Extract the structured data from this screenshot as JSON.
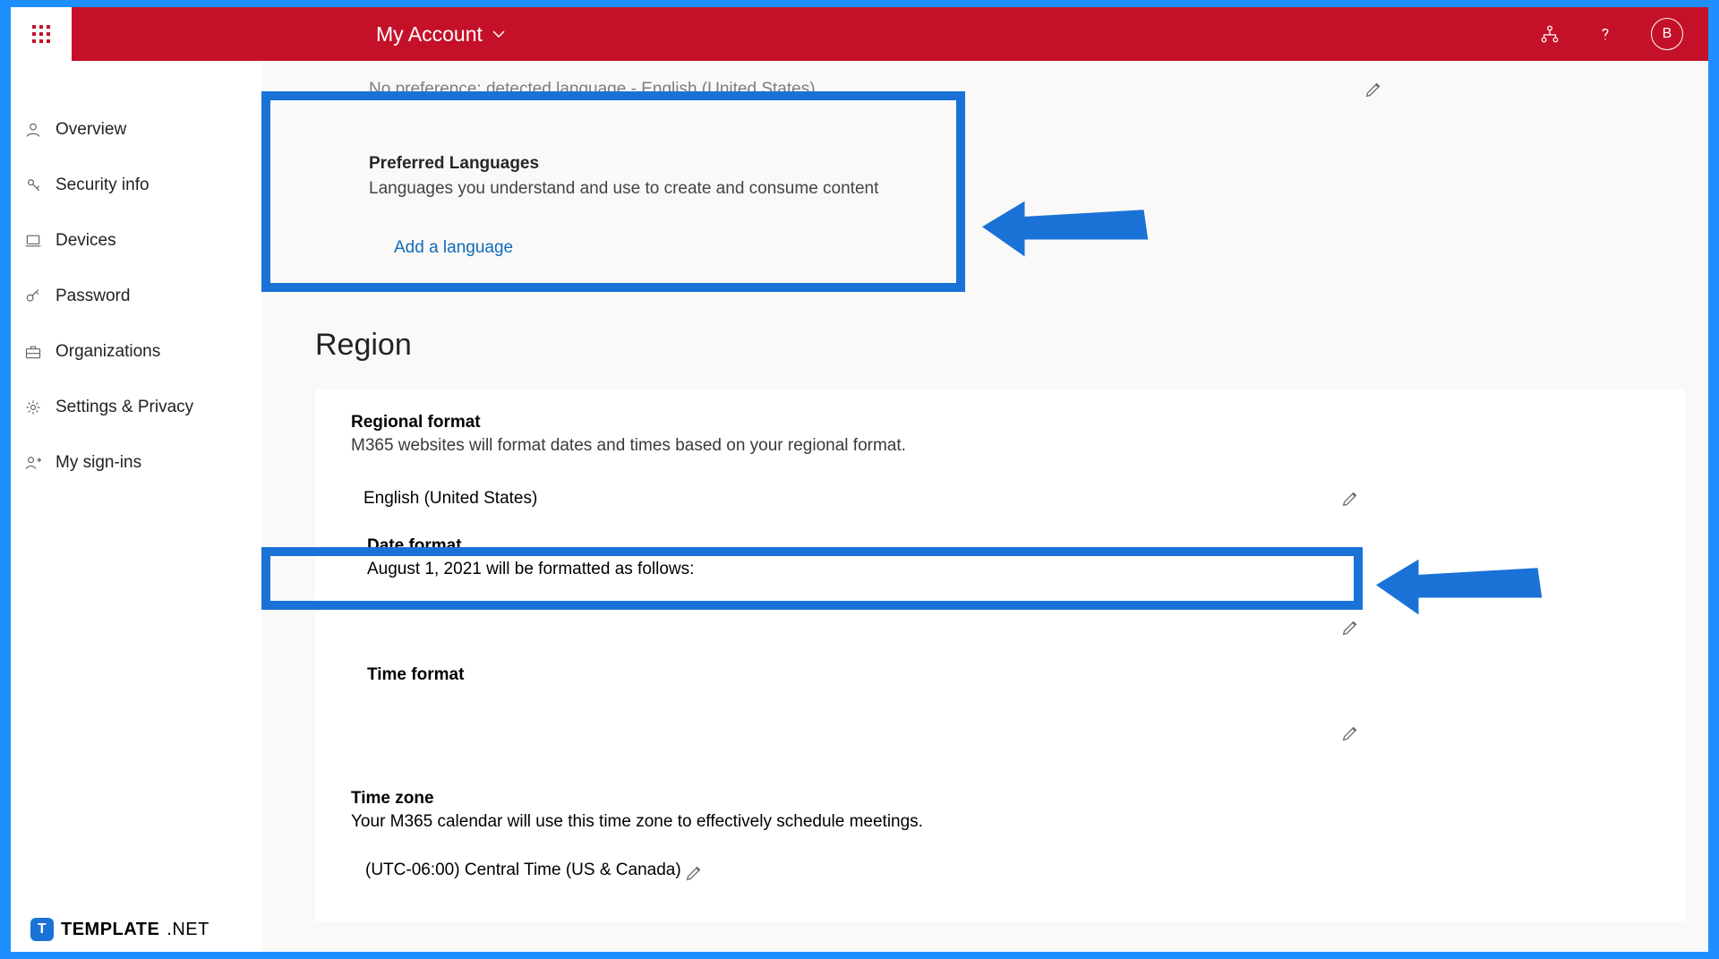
{
  "header": {
    "account_label": "My Account",
    "avatar_initial": "B"
  },
  "sidebar": {
    "items": [
      {
        "icon": "person",
        "label": "Overview"
      },
      {
        "icon": "key",
        "label": "Security info"
      },
      {
        "icon": "laptop",
        "label": "Devices"
      },
      {
        "icon": "password",
        "label": "Password"
      },
      {
        "icon": "org",
        "label": "Organizations"
      },
      {
        "icon": "gear",
        "label": "Settings & Privacy"
      },
      {
        "icon": "signins",
        "label": "My sign-ins"
      }
    ]
  },
  "lang": {
    "detected_line": "No preference: detected language - English (United States)",
    "pref_title": "Preferred Languages",
    "pref_desc": "Languages you understand and use to create and consume content",
    "add_label": "Add a language"
  },
  "region": {
    "section_title": "Region",
    "rf_title": "Regional format",
    "rf_desc": "M365 websites will format dates and times based on your regional format.",
    "rf_value": "English (United States)",
    "date_title": "Date format",
    "date_desc": "August 1, 2021 will be formatted as follows:",
    "time_title": "Time format",
    "tz_title": "Time zone",
    "tz_desc": "Your M365 calendar will use this time zone to effectively schedule meetings.",
    "tz_value": "(UTC-06:00) Central Time (US & Canada)"
  },
  "watermark": {
    "badge": "T",
    "bold": "TEMPLATE",
    "light": ".NET"
  }
}
